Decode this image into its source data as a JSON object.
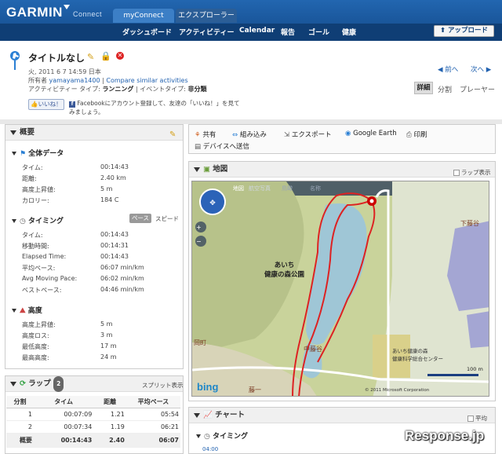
{
  "header": {
    "logo": "GARMIN",
    "logo_sub": "Connect",
    "tabs": [
      "myConnect",
      "エクスプローラー"
    ],
    "nav": [
      "ダッシュボード",
      "アクティビティー",
      "Calendar",
      "報告",
      "ゴール",
      "健康"
    ],
    "upload": "アップロード"
  },
  "activity": {
    "title": "タイトルなし",
    "date": "火, 2011 6 7 14:59 日本",
    "owner_label": "所有者",
    "owner": "yamayama1400",
    "compare": "Compare similar activities",
    "type_label": "アクティビティー タイプ",
    "type": "ランニング",
    "event_label": "イベントタイプ",
    "event": "非分類",
    "like": "いいね！",
    "fb_text": "Facebookにアカウント登録して、友達の「いいね！」を見てみましょう。",
    "prev": "前へ",
    "next": "次へ",
    "views": [
      "詳細",
      "分割",
      "プレーヤー"
    ]
  },
  "summary": {
    "title": "概要",
    "overall_title": "全体データ",
    "overall": [
      {
        "label": "タイム:",
        "value": "00:14:43"
      },
      {
        "label": "距離:",
        "value": "2.40 km"
      },
      {
        "label": "高度上昇値:",
        "value": "5 m"
      },
      {
        "label": "カロリー:",
        "value": "184 C"
      }
    ],
    "timing_title": "タイミング",
    "timing_pace": "ペース",
    "timing_speed": "スピード",
    "timing": [
      {
        "label": "タイム:",
        "value": "00:14:43"
      },
      {
        "label": "移動時間:",
        "value": "00:14:31"
      },
      {
        "label": "Elapsed Time:",
        "value": "00:14:43"
      },
      {
        "label": "平均ペース:",
        "value": "06:07 min/km"
      },
      {
        "label": "Avg Moving Pace:",
        "value": "06:02 min/km"
      },
      {
        "label": "ベストペース:",
        "value": "04:46 min/km"
      }
    ],
    "elev_title": "高度",
    "elev": [
      {
        "label": "高度上昇値:",
        "value": "5 m"
      },
      {
        "label": "高度ロス:",
        "value": "3 m"
      },
      {
        "label": "最低高度:",
        "value": "17 m"
      },
      {
        "label": "最高高度:",
        "value": "24 m"
      }
    ]
  },
  "laps": {
    "title": "ラップ",
    "count": "2",
    "split_show": "スプリット表示",
    "headers": [
      "分割",
      "タイム",
      "距離",
      "平均ペース"
    ],
    "rows": [
      [
        "1",
        "00:07:09",
        "1.21",
        "05:54"
      ],
      [
        "2",
        "00:07:34",
        "1.19",
        "06:21"
      ]
    ],
    "total": [
      "概要",
      "00:14:43",
      "2.40",
      "06:07"
    ]
  },
  "tools": {
    "share": "共有",
    "embed": "組み込み",
    "export": "エクスポート",
    "google_earth": "Google Earth",
    "print": "印刷",
    "send": "デバイスへ送信"
  },
  "map": {
    "title": "地図",
    "lap_show": "ラップ表示",
    "types": [
      "地図",
      "航空写真",
      "鳥瞰",
      "名称"
    ],
    "labels": {
      "park": "あいち\n健康の森公園",
      "shimoura": "下藤谷",
      "nakaura": "中藤谷",
      "inst": "あいち健康の森\n健康科学総合センター",
      "town": "岡町",
      "prefix": "藤一"
    },
    "scale": "100 m",
    "bing": "bing",
    "copyright": "© 2011 Microsoft Corporation"
  },
  "chart": {
    "title": "チャート",
    "avg": "平均",
    "timing": "タイミング",
    "time": "04:00"
  },
  "watermark": "Response.jp"
}
